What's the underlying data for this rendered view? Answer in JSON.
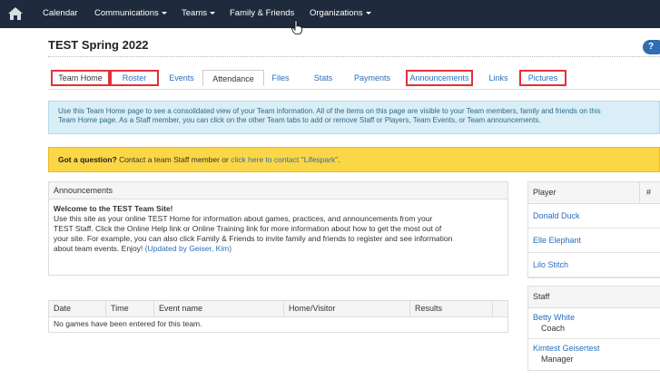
{
  "nav": {
    "items": [
      {
        "label": "Calendar",
        "caret": false
      },
      {
        "label": "Communications",
        "caret": true
      },
      {
        "label": "Teams",
        "caret": true
      },
      {
        "label": "Family & Friends",
        "caret": false
      },
      {
        "label": "Organizations",
        "caret": true
      }
    ]
  },
  "page": {
    "title": "TEST Spring 2022",
    "help_label": "?"
  },
  "tabs": [
    {
      "label": "Team Home",
      "active": true,
      "highlighted": true
    },
    {
      "label": "Roster",
      "active": false,
      "highlighted": true
    },
    {
      "label": "Events",
      "active": false,
      "highlighted": false
    },
    {
      "label": "Attendance",
      "active": true,
      "highlighted": false
    },
    {
      "label": "Files",
      "active": false,
      "highlighted": false
    },
    {
      "label": "Stats",
      "active": false,
      "highlighted": false
    },
    {
      "label": "Payments",
      "active": false,
      "highlighted": false
    },
    {
      "label": "Announcements",
      "active": false,
      "highlighted": true
    },
    {
      "label": "Links",
      "active": false,
      "highlighted": false
    },
    {
      "label": "Pictures",
      "active": false,
      "highlighted": true
    }
  ],
  "info": {
    "line1": "Use this Team Home page to see a consolidated view of your Team information. All of the items on this page are visible to your Team members, family and friends on this",
    "line2": "Team Home page. As a Staff member, you can click on the other Team tabs to add or remove Staff or Players, Team Events, or Team announcements."
  },
  "question": {
    "bold": "Got a question?",
    "text": " Contact a team Staff member or ",
    "link": "click here to contact \"Lifespark\"",
    "end": "."
  },
  "announcements": {
    "header": "Announcements",
    "headline": "Welcome to the TEST Team Site!",
    "lines": [
      "Use this site as your online TEST Home for information about games, practices, and announcements from your",
      "TEST Staff. Click the Online Help link or Online Training link for more information about how to get the most out of",
      "your site. For example, you can also click Family & Friends to invite family and friends to register and see information"
    ],
    "last_line": "about team events. Enjoy!",
    "updated_by": "(Updated by Geiser, Kim)"
  },
  "events": {
    "columns": [
      "Date",
      "Time",
      "Event name",
      "Home/Visitor",
      "Results"
    ],
    "empty_text": "No games have been entered for this team."
  },
  "players": {
    "header": "Player",
    "num_header": "#",
    "rows": [
      "Donald Duck",
      "Elle Elephant",
      "Lilo Stitch"
    ]
  },
  "staff": {
    "header": "Staff",
    "rows": [
      {
        "name": "Betty White",
        "role": "Coach"
      },
      {
        "name": "Kimtest Geisertest",
        "role": "Manager"
      }
    ]
  },
  "colors": {
    "nav_bg": "#1f2b3c",
    "link": "#2a6ebb",
    "highlight_border": "#e0313a",
    "info_bg": "#d9eef6",
    "question_bg": "#fbd646"
  }
}
